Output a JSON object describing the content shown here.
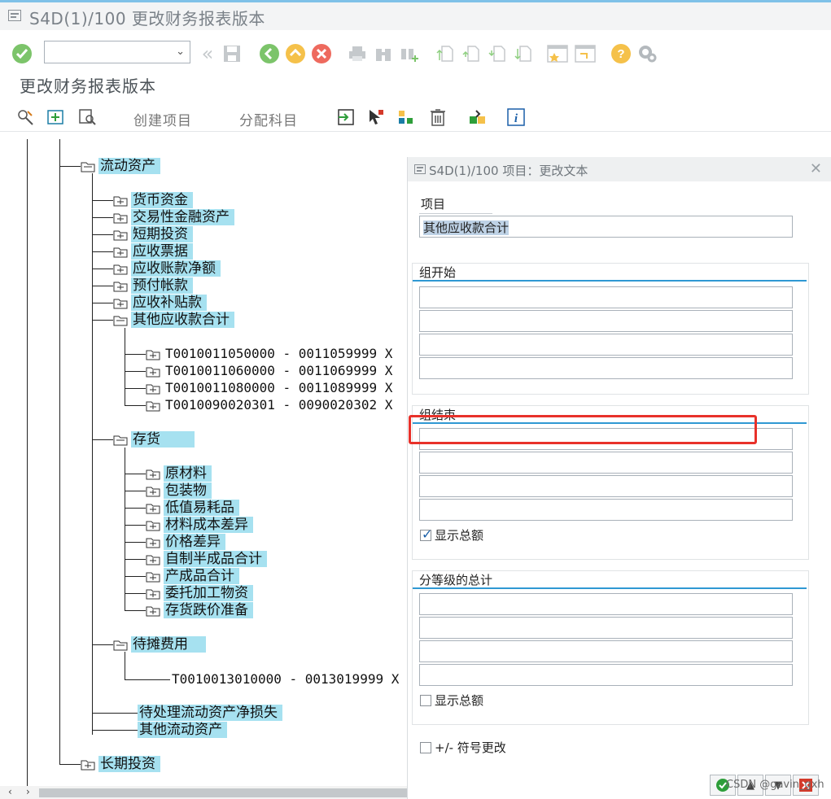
{
  "window": {
    "title": "S4D(1)/100 更改财务报表版本"
  },
  "toolbar": {
    "command_value": ""
  },
  "screen": {
    "title": "更改财务报表版本"
  },
  "appbar": {
    "create_item": "创建项目",
    "assign_accounts": "分配科目"
  },
  "tree": {
    "current_assets": "流动资产",
    "cash": "货币资金",
    "trading_fin": "交易性金融资产",
    "short_invest": "短期投资",
    "notes_recv": "应收票据",
    "acct_recv_net": "应收账款净额",
    "prepay": "预付帐款",
    "subsidy_recv": "应收补贴款",
    "other_recv_total": "其他应收款合计",
    "acct_1": "T0010011050000 - 0011059999 X",
    "acct_2": "T0010011060000 - 0011069999 X",
    "acct_3": "T0010011080000 - 0011089999 X",
    "acct_4": "T0010090020301 - 0090020302 X",
    "inventory": "存货",
    "raw_mat": "原材料",
    "packaging": "包装物",
    "low_value": "低值易耗品",
    "mat_cost_var": "材料成本差异",
    "price_var": "价格差异",
    "semi_finished": "自制半成品合计",
    "finished": "产成品合计",
    "consign": "委托加工物资",
    "inv_impair": "存货跌价准备",
    "deferred": "待摊费用",
    "acct_5": "T0010013010000 - 0013019999 X",
    "pending_loss": "待处理流动资产净损失",
    "other_current": "其他流动资产",
    "long_invest": "长期投资"
  },
  "dialog": {
    "title": "S4D(1)/100 项目：更改文本",
    "item_label": "项目",
    "item_value": "其他应收款合计",
    "group_start": "组开始",
    "group_end": "组结束",
    "show_total": "显示总额",
    "show_total_checked": true,
    "graded_total": "分等级的总计",
    "show_total_2": "显示总额",
    "show_total_2_checked": false,
    "sign_change": "+/- 符号更改",
    "sign_change_checked": false
  },
  "watermark": "CSDN @gavin_gxh",
  "colors": {
    "highlight": "#a6e1f0",
    "accent": "#2f98d3",
    "alert": "#e8312a"
  }
}
